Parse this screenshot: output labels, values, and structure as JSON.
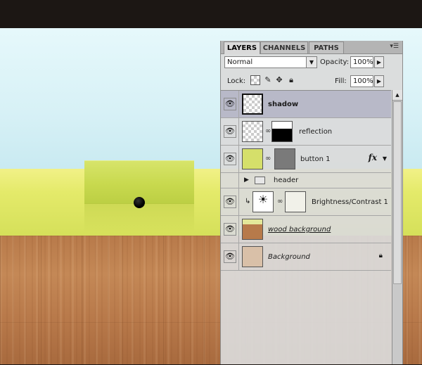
{
  "panel": {
    "tabs": [
      {
        "label": "LAYERS",
        "active": true
      },
      {
        "label": "CHANNELS",
        "active": false
      },
      {
        "label": "PATHS",
        "active": false
      }
    ],
    "blend_mode": "Normal",
    "opacity_label": "Opacity:",
    "opacity_value": "100%",
    "lock_label": "Lock:",
    "fill_label": "Fill:",
    "fill_value": "100%"
  },
  "layers": [
    {
      "name": "shadow",
      "selected": true,
      "visible": true
    },
    {
      "name": "reflection",
      "selected": false,
      "visible": true,
      "has_mask": true
    },
    {
      "name": "button 1",
      "selected": false,
      "visible": true,
      "has_mask": true,
      "has_fx": true,
      "fx_label": "fx"
    },
    {
      "name": "header",
      "selected": false,
      "visible": false,
      "type": "group"
    },
    {
      "name": "Brightness/Contrast 1",
      "selected": false,
      "visible": true,
      "type": "adjustment",
      "clipped": true
    },
    {
      "name": "wood background",
      "selected": false,
      "visible": true
    },
    {
      "name": "Background",
      "selected": false,
      "visible": true,
      "locked": true
    }
  ],
  "colors": {
    "lime": "#dfe863",
    "button": "#c8d94e",
    "sky": "#d7f1f6",
    "wood": "#c08452",
    "selected_row": "#b8b9c8"
  },
  "icons": {
    "eye": "eye-icon",
    "chain": "link-icon",
    "folder": "folder-icon",
    "lock": "lock-icon",
    "fx": "fx-icon"
  }
}
